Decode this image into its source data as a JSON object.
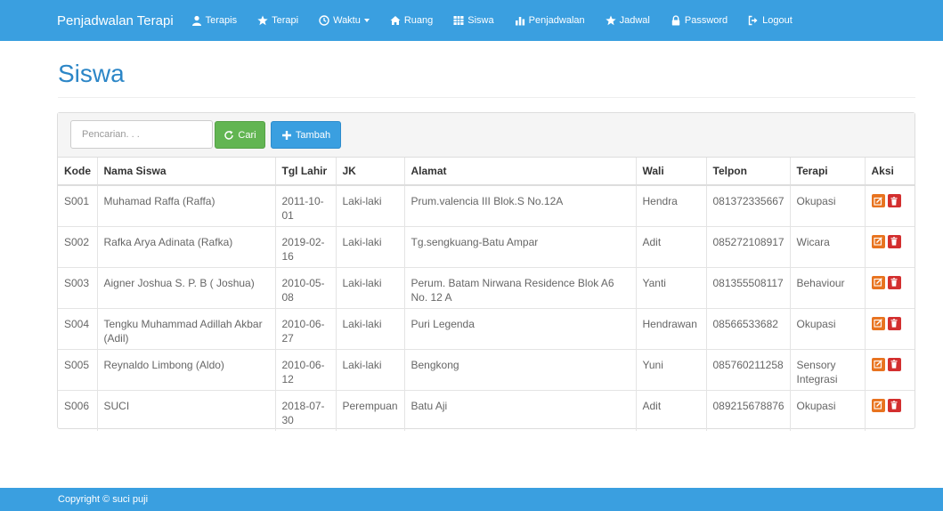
{
  "navbar": {
    "brand": "Penjadwalan Terapi",
    "items": [
      {
        "label": "Terapis",
        "icon": "user-icon"
      },
      {
        "label": "Terapi",
        "icon": "star-icon"
      },
      {
        "label": "Waktu",
        "icon": "clock-icon"
      },
      {
        "label": "Ruang",
        "icon": "home-icon"
      },
      {
        "label": "Siswa",
        "icon": "grid-icon"
      },
      {
        "label": "Penjadwalan",
        "icon": "bar-chart-icon"
      },
      {
        "label": "Jadwal",
        "icon": "star-icon"
      },
      {
        "label": "Password",
        "icon": "lock-icon"
      },
      {
        "label": "Logout",
        "icon": "logout-icon"
      }
    ]
  },
  "page": {
    "title": "Siswa"
  },
  "toolbar": {
    "search_placeholder": "Pencarian. . .",
    "search_value": "",
    "cari_label": "Cari",
    "tambah_label": "Tambah"
  },
  "table": {
    "headers": [
      "Kode",
      "Nama Siswa",
      "Tgl Lahir",
      "JK",
      "Alamat",
      "Wali",
      "Telpon",
      "Terapi",
      "Aksi"
    ],
    "rows": [
      [
        "S001",
        "Muhamad Raffa (Raffa)",
        "2011-10-01",
        "Laki-laki",
        "Prum.valencia III Blok.S No.12A",
        "Hendra",
        "081372335667",
        "Okupasi"
      ],
      [
        "S002",
        "Rafka Arya Adinata (Rafka)",
        "2019-02-16",
        "Laki-laki",
        "Tg.sengkuang-Batu Ampar",
        "Adit",
        "085272108917",
        "Wicara"
      ],
      [
        "S003",
        "Aigner Joshua S. P. B ( Joshua)",
        "2010-05-08",
        "Laki-laki",
        "Perum. Batam Nirwana Residence Blok A6 No. 12 A",
        "Yanti",
        "081355508117",
        "Behaviour"
      ],
      [
        "S004",
        "Tengku Muhammad Adillah Akbar (Adil)",
        "2010-06-27",
        "Laki-laki",
        "Puri Legenda",
        "Hendrawan",
        "08566533682",
        "Okupasi"
      ],
      [
        "S005",
        "Reynaldo Limbong (Aldo)",
        "2010-06-12",
        "Laki-laki",
        "Bengkong",
        "Yuni",
        "085760211258",
        "Sensory Integrasi"
      ],
      [
        "S006",
        "SUCI",
        "2018-07-30",
        "Perempuan",
        "Batu Aji",
        "Adit",
        "089215678876",
        "Okupasi"
      ]
    ]
  },
  "footer": {
    "text": "Copyright © suci puji"
  },
  "colors": {
    "primary": "#3a9fe0",
    "title": "#2c86c7",
    "success": "#62b552",
    "edit": "#e8731f",
    "delete": "#d32f2f"
  }
}
